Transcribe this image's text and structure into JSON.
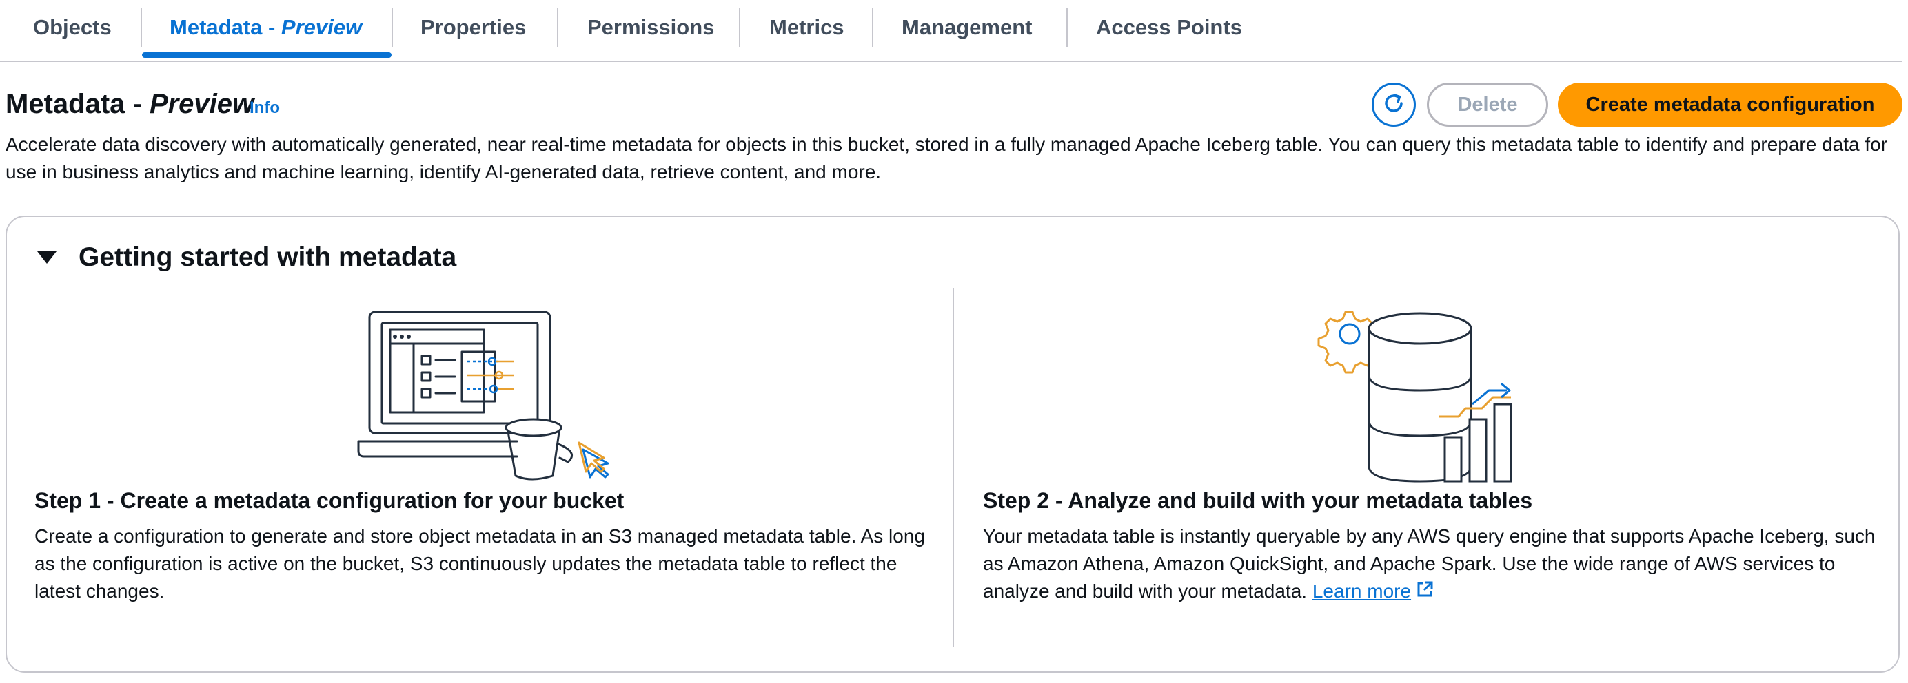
{
  "tabs": {
    "objects": "Objects",
    "metadata_main": "Metadata - ",
    "metadata_em": "Preview",
    "properties": "Properties",
    "permissions": "Permissions",
    "metrics": "Metrics",
    "management": "Management",
    "access_points": "Access Points"
  },
  "header": {
    "title_main": "Metadata - ",
    "title_em": "Preview",
    "info": "Info",
    "delete_label": "Delete",
    "create_label": "Create metadata configuration",
    "description": "Accelerate data discovery with automatically generated, near real-time metadata for objects in this bucket, stored in a fully managed Apache Iceberg table. You can query this metadata table to identify and prepare data for use in business analytics and machine learning, identify AI-generated data, retrieve content, and more."
  },
  "getting_started": {
    "title": "Getting started with metadata",
    "step1": {
      "title": "Step 1 - Create a metadata configuration for your bucket",
      "body": "Create a configuration to generate and store object metadata in an S3 managed metadata table. As long as the configuration is active on the bucket, S3 continuously updates the metadata table to reflect the latest changes."
    },
    "step2": {
      "title": "Step 2 - Analyze and build with your metadata tables",
      "body": "Your metadata table is instantly queryable by any AWS query engine that supports Apache Iceberg, such as Amazon Athena, Amazon QuickSight, and Apache Spark. Use the wide range of AWS services to analyze and build with your metadata. ",
      "link": "Learn more"
    }
  },
  "icons": {
    "refresh": "refresh-icon",
    "caret": "caret-down-icon",
    "external": "external-link-icon"
  },
  "colors": {
    "accent": "#0972d3",
    "primary_button": "#ff9900",
    "illustration_orange": "#e8a030"
  }
}
